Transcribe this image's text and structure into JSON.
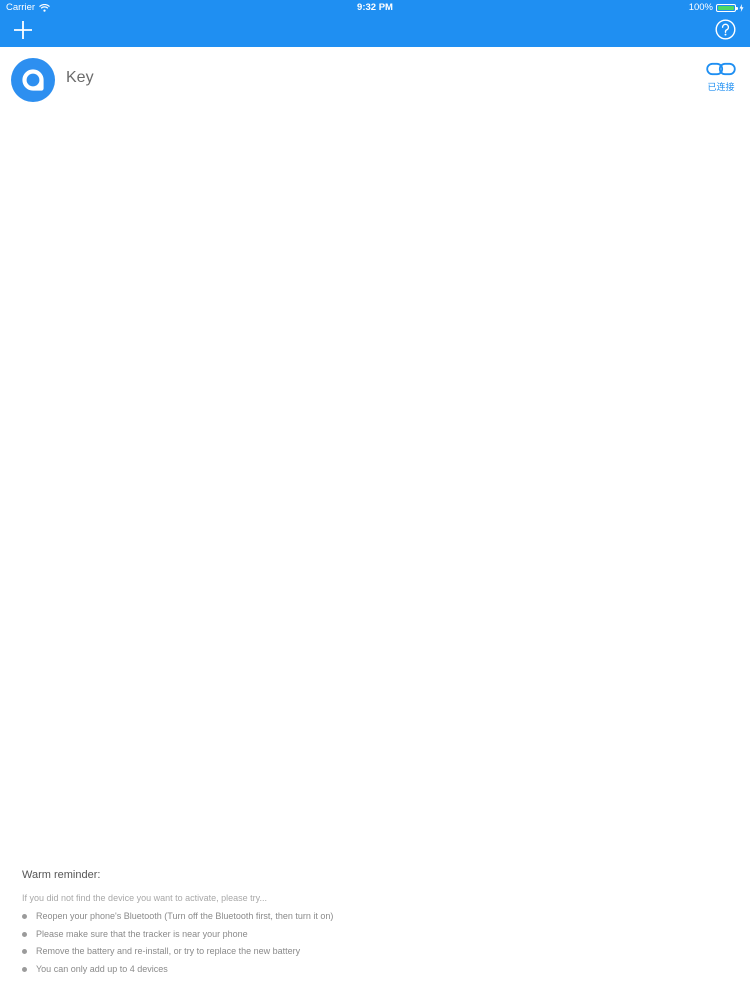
{
  "status_bar": {
    "carrier": "Carrier",
    "time": "9:32 PM",
    "battery": "100%",
    "battery_level": 1.0,
    "battery_color": "#4cd964"
  },
  "nav_bar": {
    "background": "#1f8ff2",
    "left_icon": "plus-icon",
    "right_icon": "help-icon"
  },
  "device": {
    "name": "Key",
    "icon": "device-ring-icon",
    "status_icon": "link-icon",
    "status_label": "已连接",
    "accent": "#1f8ff2"
  },
  "reminder": {
    "title": "Warm reminder:",
    "intro": "If you did not find the device you want to activate, please try...",
    "tips": [
      "Reopen your phone's Bluetooth (Turn off the Bluetooth first, then turn it on)",
      "Please make sure that the tracker is near your phone",
      "Remove the battery and re-install, or try to replace the new battery",
      "You can only add up to 4 devices"
    ]
  }
}
